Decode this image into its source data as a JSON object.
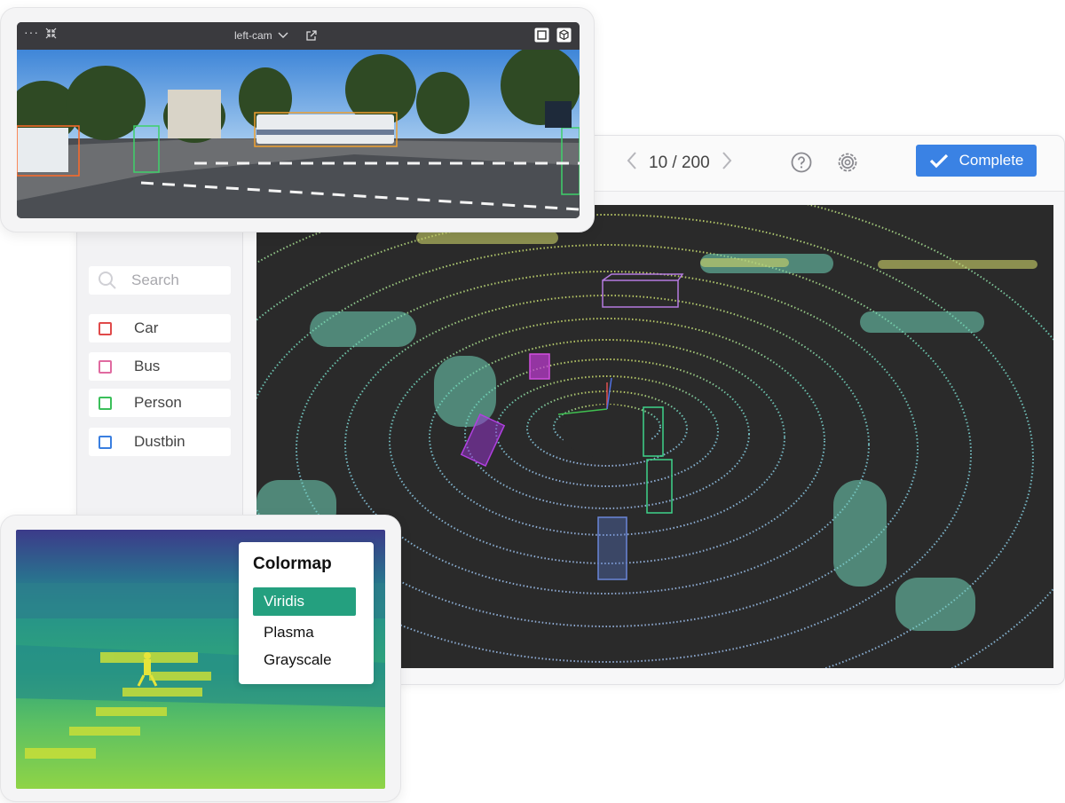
{
  "toolbar": {
    "pager_text": "10 / 200",
    "prev_icon": "chevron-left-icon",
    "next_icon": "chevron-right-icon",
    "help_icon": "question-circle-icon",
    "settings_icon": "gear-icon",
    "complete_label": "Complete",
    "accent": "#3a82e4"
  },
  "sidebar": {
    "search_placeholder": "Search",
    "labels": [
      {
        "name": "Car",
        "color": "#e04a4a"
      },
      {
        "name": "Bus",
        "color": "#e06aa0"
      },
      {
        "name": "Person",
        "color": "#3bbf5a"
      },
      {
        "name": "Dustbin",
        "color": "#3a7fe0"
      }
    ]
  },
  "camera": {
    "title": "left-cam",
    "menu_icon": "ellipsis-icon",
    "collapse_icon": "collapse-icon",
    "popout_icon": "external-link-icon",
    "box_icon": "square-icon",
    "cube_icon": "cube-icon"
  },
  "colormap": {
    "title": "Colormap",
    "options": [
      "Viridis",
      "Plasma",
      "Grayscale"
    ],
    "selected": "Viridis",
    "selected_color": "#24a07f"
  }
}
